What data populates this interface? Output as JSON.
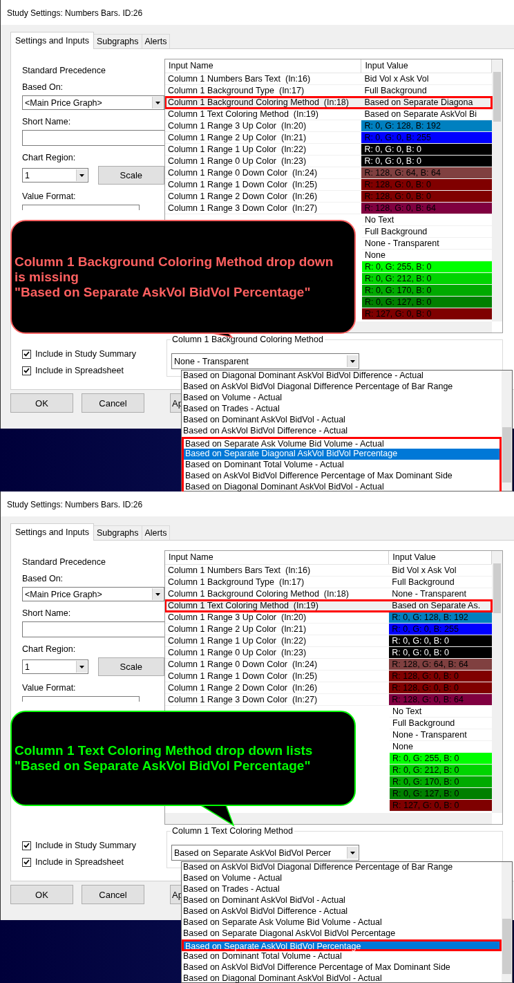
{
  "panels": [
    {
      "window": {
        "title": "Study Settings: Numbers Bars. ID:26"
      },
      "tabs": [
        {
          "label": "Settings and Inputs",
          "selected": true
        },
        {
          "label": "Subgraphs",
          "selected": false
        },
        {
          "label": "Alerts",
          "selected": false
        }
      ],
      "left": {
        "heading": "Standard Precedence",
        "based_on": {
          "label": "Based On:",
          "value": "<Main Price Graph>"
        },
        "short_name": {
          "label": "Short Name:"
        },
        "chart_region": {
          "label": "Chart Region:",
          "value": "1"
        },
        "scale_button": "Scale",
        "value_format": {
          "label": "Value Format:"
        },
        "checkboxes": [
          {
            "label": "Include in Study Summary",
            "checked": true
          },
          {
            "label": "Include in Spreadsheet",
            "checked": true
          }
        ]
      },
      "table": {
        "columns": [
          "Input Name",
          "Input Value"
        ],
        "rows": [
          {
            "name": "Column 1 Numbers Bars Text  (In:16)",
            "value": "Bid Vol x Ask Vol",
            "highlighted": false
          },
          {
            "name": "Column 1 Background Type  (In:17)",
            "value": "Full Background",
            "highlighted": false
          },
          {
            "name": "Column 1 Background Coloring Method  (In:18)",
            "value": "Based on Separate Diagona",
            "highlighted": true
          },
          {
            "name": "Column 1 Text Coloring Method  (In:19)",
            "value": "Based on Separate AskVol Bi",
            "highlighted": false
          },
          {
            "name": "Column 1 Range 3 Up Color  (In:20)",
            "value": "R: 0, G: 128, B: 192",
            "color": "#0080c0",
            "highlighted": false
          },
          {
            "name": "Column 1 Range 2 Up Color  (In:21)",
            "value": "R: 0, G: 0, B: 255",
            "color": "#0000ff",
            "highlighted": false
          },
          {
            "name": "Column 1 Range 1 Up Color  (In:22)",
            "value": "R: 0, G: 0, B: 0",
            "color": "#000000",
            "highlighted": false
          },
          {
            "name": "Column 1 Range 0 Up Color  (In:23)",
            "value": "R: 0, G: 0, B: 0",
            "color": "#000000",
            "highlighted": false
          },
          {
            "name": "Column 1 Range 0 Down Color  (In:24)",
            "value": "R: 128, G: 64, B: 64",
            "color": "#804040",
            "highlighted": false
          },
          {
            "name": "Column 1 Range 1 Down Color  (In:25)",
            "value": "R: 128, G: 0, B: 0",
            "color": "#800000",
            "highlighted": false
          },
          {
            "name": "Column 1 Range 2 Down Color  (In:26)",
            "value": "R: 128, G: 0, B: 0",
            "color": "#800000",
            "highlighted": false
          },
          {
            "name": "Column 1 Range 3 Down Color  (In:27)",
            "value": "R: 128, G: 0, B: 64",
            "color": "#800040",
            "highlighted": false
          },
          {
            "value": "No Text",
            "highlighted": false
          },
          {
            "value": "Full Background",
            "highlighted": false
          },
          {
            "value": "None - Transparent",
            "highlighted": false
          },
          {
            "value": "None",
            "highlighted": false
          },
          {
            "value": "R: 0, G: 255, B: 0",
            "color": "#00ff00",
            "highlighted": false
          },
          {
            "value": "R: 0, G: 212, B: 0",
            "color": "#00d400",
            "highlighted": false
          },
          {
            "value": "R: 0, G: 170, B: 0",
            "color": "#00aa00",
            "highlighted": false
          },
          {
            "value": "R: 0, G: 127, B: 0",
            "color": "#007f00",
            "highlighted": false
          },
          {
            "value": "R: 127, G: 0, B: 0",
            "color": "#7f0000",
            "highlighted": false
          }
        ]
      },
      "group": {
        "label": "Column 1 Background Coloring Method",
        "value": "None - Transparent"
      },
      "dropdown": {
        "items": [
          {
            "label": "Based on Diagonal Dominant AskVol BidVol Difference - Actual",
            "selected": false,
            "highlighted": false
          },
          {
            "label": "Based on AskVol BidVol Diagonal Difference Percentage of Bar Range",
            "selected": false,
            "highlighted": false
          },
          {
            "label": "Based on Volume - Actual",
            "selected": false,
            "highlighted": false
          },
          {
            "label": "Based on Trades - Actual",
            "selected": false,
            "highlighted": false
          },
          {
            "label": "Based on Dominant AskVol BidVol - Actual",
            "selected": false,
            "highlighted": false
          },
          {
            "label": "Based on AskVol BidVol Difference - Actual",
            "selected": false,
            "highlighted": false
          },
          {
            "label": "Based on Separate Ask Volume Bid Volume - Actual",
            "selected": false,
            "highlighted": true
          },
          {
            "label": "Based on Separate Diagonal AskVol BidVol Percentage",
            "selected": true,
            "highlighted": true
          },
          {
            "label": "Based on Dominant Total Volume - Actual",
            "selected": false,
            "highlighted": true
          },
          {
            "label": "Based on AskVol BidVol Difference Percentage of Max Dominant Side",
            "selected": false,
            "highlighted": true
          },
          {
            "label": "Based on Diagonal Dominant AskVol BidVol - Actual",
            "selected": false,
            "highlighted": true
          }
        ]
      },
      "buttons": [
        "OK",
        "Cancel",
        "Ap"
      ],
      "callout": {
        "color": "#ff6060",
        "lines": [
          "Column 1 Background Coloring Method drop down",
          "is missing",
          "\"Based on Separate AskVol BidVol Percentage\""
        ]
      }
    },
    {
      "window": {
        "title": "Study Settings: Numbers Bars. ID:26"
      },
      "tabs": [
        {
          "label": "Settings and Inputs",
          "selected": true
        },
        {
          "label": "Subgraphs",
          "selected": false
        },
        {
          "label": "Alerts",
          "selected": false
        }
      ],
      "left": {
        "heading": "Standard Precedence",
        "based_on": {
          "label": "Based On:",
          "value": "<Main Price Graph>"
        },
        "short_name": {
          "label": "Short Name:"
        },
        "chart_region": {
          "label": "Chart Region:",
          "value": "1"
        },
        "scale_button": "Scale",
        "value_format": {
          "label": "Value Format:"
        },
        "checkboxes": [
          {
            "label": "Include in Study Summary",
            "checked": true
          },
          {
            "label": "Include in Spreadsheet",
            "checked": true
          }
        ]
      },
      "table": {
        "columns": [
          "Input Name",
          "Input Value"
        ],
        "rows": [
          {
            "name": "Column 1 Numbers Bars Text  (In:16)",
            "value": "Bid Vol x Ask Vol",
            "highlighted": false
          },
          {
            "name": "Column 1 Background Type  (In:17)",
            "value": "Full Background",
            "highlighted": false
          },
          {
            "name": "Column 1 Background Coloring Method  (In:18)",
            "value": "None - Transparent",
            "highlighted": false
          },
          {
            "name": "Column 1 Text Coloring Method  (In:19)",
            "value": "Based on Separate As.",
            "highlighted": true
          },
          {
            "name": "Column 1 Range 3 Up Color  (In:20)",
            "value": "R: 0, G: 128, B: 192",
            "color": "#0080c0",
            "highlighted": false
          },
          {
            "name": "Column 1 Range 2 Up Color  (In:21)",
            "value": "R: 0, G: 0, B: 255",
            "color": "#0000ff",
            "highlighted": false
          },
          {
            "name": "Column 1 Range 1 Up Color  (In:22)",
            "value": "R: 0, G: 0, B: 0",
            "color": "#000000",
            "highlighted": false
          },
          {
            "name": "Column 1 Range 0 Up Color  (In:23)",
            "value": "R: 0, G: 0, B: 0",
            "color": "#000000",
            "highlighted": false
          },
          {
            "name": "Column 1 Range 0 Down Color  (In:24)",
            "value": "R: 128, G: 64, B: 64",
            "color": "#804040",
            "highlighted": false
          },
          {
            "name": "Column 1 Range 1 Down Color  (In:25)",
            "value": "R: 128, G: 0, B: 0",
            "color": "#800000",
            "highlighted": false
          },
          {
            "name": "Column 1 Range 2 Down Color  (In:26)",
            "value": "R: 128, G: 0, B: 0",
            "color": "#800000",
            "highlighted": false
          },
          {
            "name": "Column 1 Range 3 Down Color  (In:27)",
            "value": "R: 128, G: 0, B: 64",
            "color": "#800040",
            "highlighted": false
          },
          {
            "value": "No Text",
            "highlighted": false
          },
          {
            "value": "Full Background",
            "highlighted": false
          },
          {
            "value": "None - Transparent",
            "highlighted": false
          },
          {
            "value": "None",
            "highlighted": false
          },
          {
            "value": "R: 0, G: 255, B: 0",
            "color": "#00ff00",
            "highlighted": false
          },
          {
            "value": "R: 0, G: 212, B: 0",
            "color": "#00d400",
            "highlighted": false
          },
          {
            "value": "R: 0, G: 170, B: 0",
            "color": "#00aa00",
            "highlighted": false
          },
          {
            "value": "R: 0, G: 127, B: 0",
            "color": "#007f00",
            "highlighted": false
          },
          {
            "value": "R: 127, G: 0, B: 0",
            "color": "#7f0000",
            "highlighted": false
          }
        ]
      },
      "group": {
        "label": "Column 1 Text Coloring Method",
        "value": "Based on Separate AskVol BidVol Percer"
      },
      "dropdown": {
        "items": [
          {
            "label": "Based on AskVol BidVol Diagonal Difference Percentage of Bar Range",
            "selected": false,
            "highlighted": false
          },
          {
            "label": "Based on Volume - Actual",
            "selected": false,
            "highlighted": false
          },
          {
            "label": "Based on Trades - Actual",
            "selected": false,
            "highlighted": false
          },
          {
            "label": "Based on Dominant AskVol BidVol - Actual",
            "selected": false,
            "highlighted": false
          },
          {
            "label": "Based on AskVol BidVol Difference - Actual",
            "selected": false,
            "highlighted": false
          },
          {
            "label": "Based on Separate Ask Volume Bid Volume - Actual",
            "selected": false,
            "highlighted": false
          },
          {
            "label": "Based on Separate Diagonal AskVol BidVol Percentage",
            "selected": false,
            "highlighted": false
          },
          {
            "label": "Based on Separate AskVol BidVol Percentage",
            "selected": true,
            "highlighted": true
          },
          {
            "label": "Based on Dominant Total Volume - Actual",
            "selected": false,
            "highlighted": false
          },
          {
            "label": "Based on AskVol BidVol Difference Percentage of Max Dominant Side",
            "selected": false,
            "highlighted": false
          },
          {
            "label": "Based on Diagonal Dominant AskVol BidVol - Actual",
            "selected": false,
            "highlighted": false
          }
        ]
      },
      "buttons": [
        "OK",
        "Cancel",
        "Ap"
      ],
      "callout": {
        "color": "#00ff00",
        "lines": [
          "Column 1 Text Coloring Method drop down lists",
          "\"Based on Separate AskVol BidVol Percentage\""
        ]
      }
    }
  ]
}
